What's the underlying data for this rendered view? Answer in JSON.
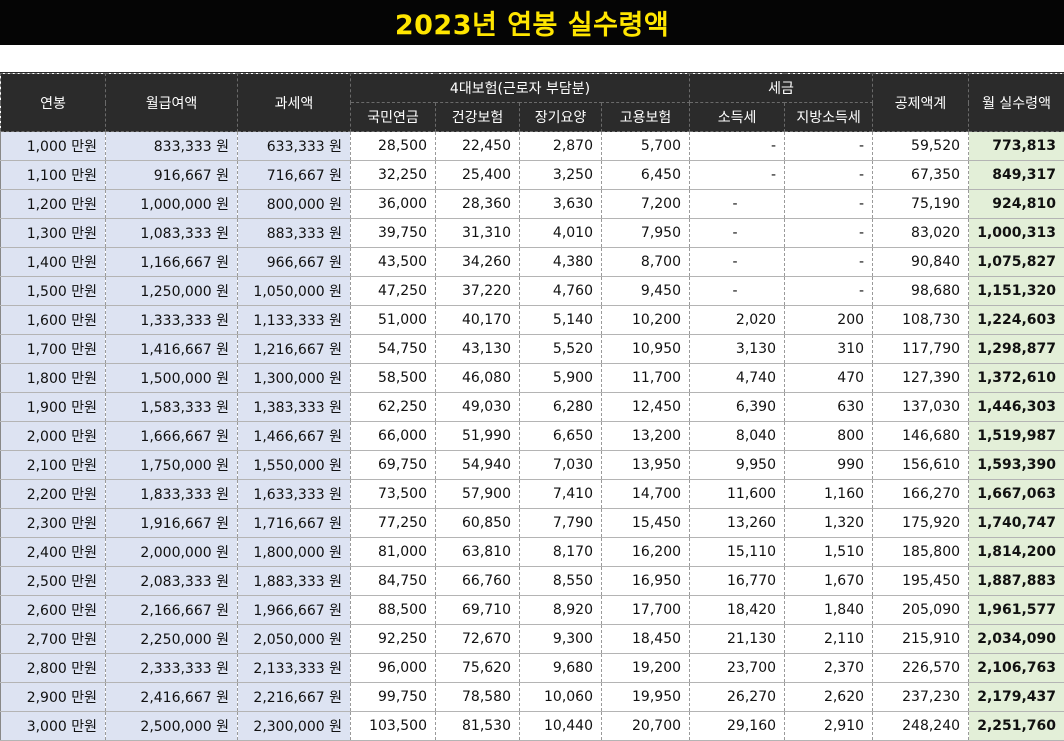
{
  "title": "2023년 연봉 실수령액",
  "headers": {
    "salary": "연봉",
    "monthly": "월급여액",
    "taxable": "과세액",
    "insurance_group": "4대보험(근로자 부담분)",
    "pension": "국민연금",
    "health": "건강보험",
    "longterm": "장기요양",
    "employment": "고용보험",
    "tax_group": "세금",
    "income_tax": "소득세",
    "local_tax": "지방소득세",
    "deduction": "공제액계",
    "net": "월 실수령액"
  },
  "rows": [
    {
      "salary": "1,000 만원",
      "monthly": "833,333 원",
      "taxable": "633,333 원",
      "pension": "28,500",
      "health": "22,450",
      "longterm": "2,870",
      "employment": "5,700",
      "income_tax": "-",
      "local_tax": "-",
      "deduction": "59,520",
      "net": "773,813"
    },
    {
      "salary": "1,100 만원",
      "monthly": "916,667 원",
      "taxable": "716,667 원",
      "pension": "32,250",
      "health": "25,400",
      "longterm": "3,250",
      "employment": "6,450",
      "income_tax": "-",
      "local_tax": "-",
      "deduction": "67,350",
      "net": "849,317"
    },
    {
      "salary": "1,200 만원",
      "monthly": "1,000,000 원",
      "taxable": "800,000 원",
      "pension": "36,000",
      "health": "28,360",
      "longterm": "3,630",
      "employment": "7,200",
      "income_tax": "-",
      "local_tax": "-",
      "deduction": "75,190",
      "net": "924,810"
    },
    {
      "salary": "1,300 만원",
      "monthly": "1,083,333 원",
      "taxable": "883,333 원",
      "pension": "39,750",
      "health": "31,310",
      "longterm": "4,010",
      "employment": "7,950",
      "income_tax": "-",
      "local_tax": "-",
      "deduction": "83,020",
      "net": "1,000,313"
    },
    {
      "salary": "1,400 만원",
      "monthly": "1,166,667 원",
      "taxable": "966,667 원",
      "pension": "43,500",
      "health": "34,260",
      "longterm": "4,380",
      "employment": "8,700",
      "income_tax": "-",
      "local_tax": "-",
      "deduction": "90,840",
      "net": "1,075,827"
    },
    {
      "salary": "1,500 만원",
      "monthly": "1,250,000 원",
      "taxable": "1,050,000 원",
      "pension": "47,250",
      "health": "37,220",
      "longterm": "4,760",
      "employment": "9,450",
      "income_tax": "-",
      "local_tax": "-",
      "deduction": "98,680",
      "net": "1,151,320"
    },
    {
      "salary": "1,600 만원",
      "monthly": "1,333,333 원",
      "taxable": "1,133,333 원",
      "pension": "51,000",
      "health": "40,170",
      "longterm": "5,140",
      "employment": "10,200",
      "income_tax": "2,020",
      "local_tax": "200",
      "deduction": "108,730",
      "net": "1,224,603"
    },
    {
      "salary": "1,700 만원",
      "monthly": "1,416,667 원",
      "taxable": "1,216,667 원",
      "pension": "54,750",
      "health": "43,130",
      "longterm": "5,520",
      "employment": "10,950",
      "income_tax": "3,130",
      "local_tax": "310",
      "deduction": "117,790",
      "net": "1,298,877"
    },
    {
      "salary": "1,800 만원",
      "monthly": "1,500,000 원",
      "taxable": "1,300,000 원",
      "pension": "58,500",
      "health": "46,080",
      "longterm": "5,900",
      "employment": "11,700",
      "income_tax": "4,740",
      "local_tax": "470",
      "deduction": "127,390",
      "net": "1,372,610"
    },
    {
      "salary": "1,900 만원",
      "monthly": "1,583,333 원",
      "taxable": "1,383,333 원",
      "pension": "62,250",
      "health": "49,030",
      "longterm": "6,280",
      "employment": "12,450",
      "income_tax": "6,390",
      "local_tax": "630",
      "deduction": "137,030",
      "net": "1,446,303"
    },
    {
      "salary": "2,000 만원",
      "monthly": "1,666,667 원",
      "taxable": "1,466,667 원",
      "pension": "66,000",
      "health": "51,990",
      "longterm": "6,650",
      "employment": "13,200",
      "income_tax": "8,040",
      "local_tax": "800",
      "deduction": "146,680",
      "net": "1,519,987"
    },
    {
      "salary": "2,100 만원",
      "monthly": "1,750,000 원",
      "taxable": "1,550,000 원",
      "pension": "69,750",
      "health": "54,940",
      "longterm": "7,030",
      "employment": "13,950",
      "income_tax": "9,950",
      "local_tax": "990",
      "deduction": "156,610",
      "net": "1,593,390"
    },
    {
      "salary": "2,200 만원",
      "monthly": "1,833,333 원",
      "taxable": "1,633,333 원",
      "pension": "73,500",
      "health": "57,900",
      "longterm": "7,410",
      "employment": "14,700",
      "income_tax": "11,600",
      "local_tax": "1,160",
      "deduction": "166,270",
      "net": "1,667,063"
    },
    {
      "salary": "2,300 만원",
      "monthly": "1,916,667 원",
      "taxable": "1,716,667 원",
      "pension": "77,250",
      "health": "60,850",
      "longterm": "7,790",
      "employment": "15,450",
      "income_tax": "13,260",
      "local_tax": "1,320",
      "deduction": "175,920",
      "net": "1,740,747"
    },
    {
      "salary": "2,400 만원",
      "monthly": "2,000,000 원",
      "taxable": "1,800,000 원",
      "pension": "81,000",
      "health": "63,810",
      "longterm": "8,170",
      "employment": "16,200",
      "income_tax": "15,110",
      "local_tax": "1,510",
      "deduction": "185,800",
      "net": "1,814,200"
    },
    {
      "salary": "2,500 만원",
      "monthly": "2,083,333 원",
      "taxable": "1,883,333 원",
      "pension": "84,750",
      "health": "66,760",
      "longterm": "8,550",
      "employment": "16,950",
      "income_tax": "16,770",
      "local_tax": "1,670",
      "deduction": "195,450",
      "net": "1,887,883"
    },
    {
      "salary": "2,600 만원",
      "monthly": "2,166,667 원",
      "taxable": "1,966,667 원",
      "pension": "88,500",
      "health": "69,710",
      "longterm": "8,920",
      "employment": "17,700",
      "income_tax": "18,420",
      "local_tax": "1,840",
      "deduction": "205,090",
      "net": "1,961,577"
    },
    {
      "salary": "2,700 만원",
      "monthly": "2,250,000 원",
      "taxable": "2,050,000 원",
      "pension": "92,250",
      "health": "72,670",
      "longterm": "9,300",
      "employment": "18,450",
      "income_tax": "21,130",
      "local_tax": "2,110",
      "deduction": "215,910",
      "net": "2,034,090"
    },
    {
      "salary": "2,800 만원",
      "monthly": "2,333,333 원",
      "taxable": "2,133,333 원",
      "pension": "96,000",
      "health": "75,620",
      "longterm": "9,680",
      "employment": "19,200",
      "income_tax": "23,700",
      "local_tax": "2,370",
      "deduction": "226,570",
      "net": "2,106,763"
    },
    {
      "salary": "2,900 만원",
      "monthly": "2,416,667 원",
      "taxable": "2,216,667 원",
      "pension": "99,750",
      "health": "78,580",
      "longterm": "10,060",
      "employment": "19,950",
      "income_tax": "26,270",
      "local_tax": "2,620",
      "deduction": "237,230",
      "net": "2,179,437"
    },
    {
      "salary": "3,000 만원",
      "monthly": "2,500,000 원",
      "taxable": "2,300,000 원",
      "pension": "103,500",
      "health": "81,530",
      "longterm": "10,440",
      "employment": "20,700",
      "income_tax": "29,160",
      "local_tax": "2,910",
      "deduction": "248,240",
      "net": "2,251,760"
    }
  ]
}
